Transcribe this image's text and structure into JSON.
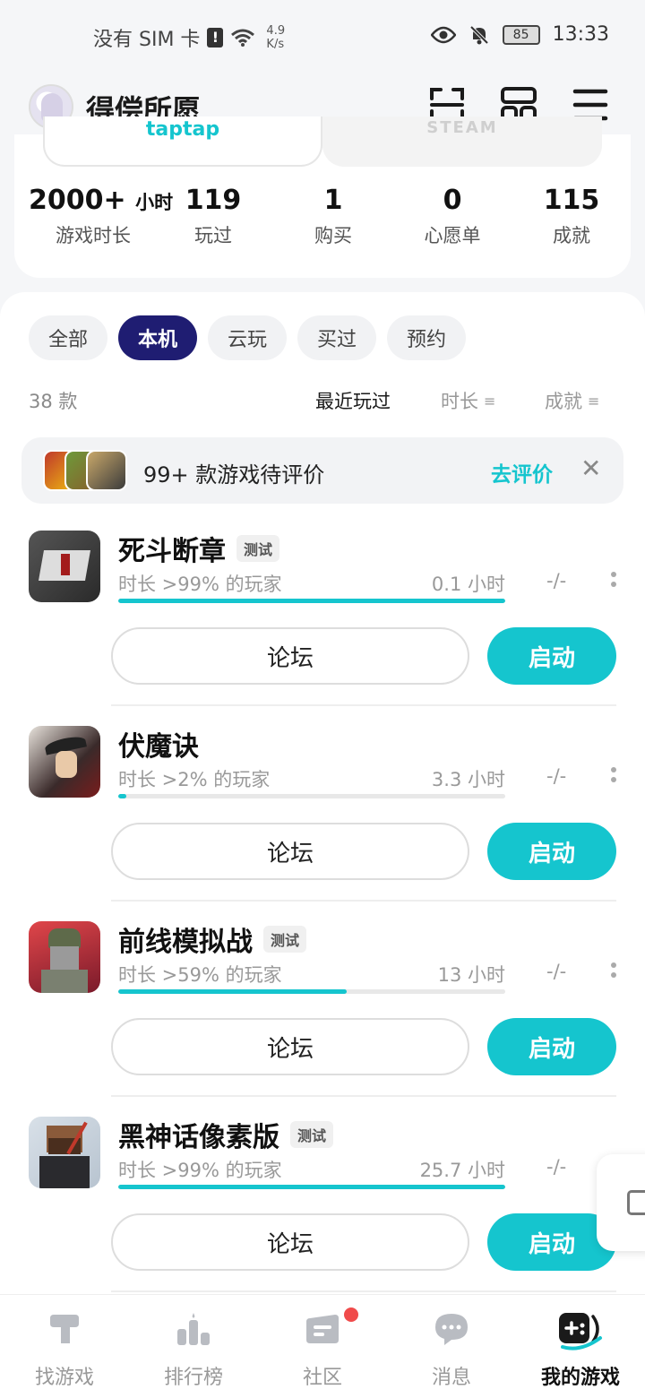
{
  "status_bar": {
    "carrier": "没有 SIM 卡",
    "speed_value": "4.9",
    "speed_unit": "K/s",
    "battery": "85",
    "time": "13:33"
  },
  "header": {
    "username": "得偿所愿"
  },
  "platforms": {
    "tap": "taptap",
    "steam": "STEAM"
  },
  "stats": [
    {
      "value": "2000+",
      "unit": "小时",
      "label": "游戏时长"
    },
    {
      "value": "119",
      "unit": "",
      "label": "玩过"
    },
    {
      "value": "1",
      "unit": "",
      "label": "购买"
    },
    {
      "value": "0",
      "unit": "",
      "label": "心愿单"
    },
    {
      "value": "115",
      "unit": "",
      "label": "成就"
    }
  ],
  "filters": [
    "全部",
    "本机",
    "云玩",
    "买过",
    "预约"
  ],
  "active_filter": "本机",
  "count_text": "38 款",
  "sorts": [
    "最近玩过",
    "时长",
    "成就"
  ],
  "review": {
    "text": "99+ 款游戏待评价",
    "link": "去评价"
  },
  "games": [
    {
      "name": "死斗断章",
      "badge": "测试",
      "percentile": "时长 >99% 的玩家",
      "hours": "0.1 小时",
      "progress": 1.0,
      "achievements": "-/-",
      "forum": "论坛",
      "start": "启动"
    },
    {
      "name": "伏魔诀",
      "badge": "",
      "percentile": "时长 >2% 的玩家",
      "hours": "3.3 小时",
      "progress": 0.02,
      "achievements": "-/-",
      "forum": "论坛",
      "start": "启动"
    },
    {
      "name": "前线模拟战",
      "badge": "测试",
      "percentile": "时长 >59% 的玩家",
      "hours": "13 小时",
      "progress": 0.59,
      "achievements": "-/-",
      "forum": "论坛",
      "start": "启动"
    },
    {
      "name": "黑神话像素版",
      "badge": "测试",
      "percentile": "时长 >99% 的玩家",
      "hours": "25.7 小时",
      "progress": 1.0,
      "achievements": "-/-",
      "forum": "论坛",
      "start": "启动"
    }
  ],
  "nav": [
    {
      "label": "找游戏",
      "icon": "find-games-icon"
    },
    {
      "label": "排行榜",
      "icon": "ranking-icon"
    },
    {
      "label": "社区",
      "icon": "community-icon"
    },
    {
      "label": "消息",
      "icon": "messages-icon"
    },
    {
      "label": "我的游戏",
      "icon": "my-games-icon"
    }
  ],
  "colors": {
    "accent": "#15c5ce",
    "active_chip": "#1f1d72",
    "notification_dot": "#f04b4b"
  }
}
